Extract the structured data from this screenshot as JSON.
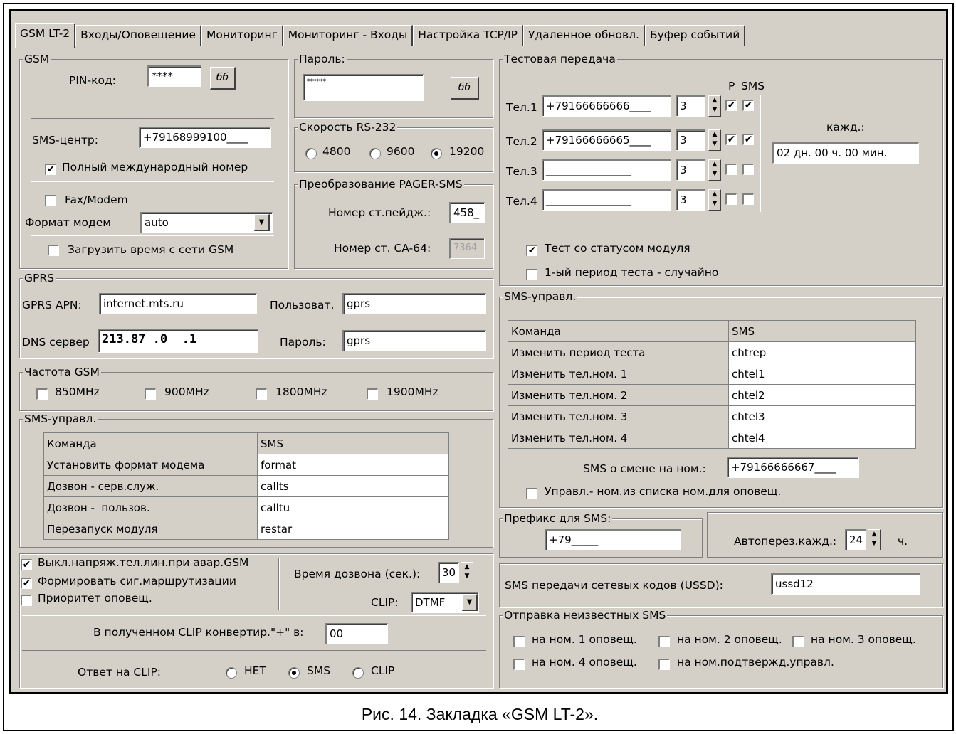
{
  "tabs": [
    "GSM LT-2",
    "Входы/Оповещение",
    "Мониторинг",
    "Мониторинг - Входы",
    "Настройка TCP/IP",
    "Удаленное обновл.",
    "Буфер событий"
  ],
  "gsm": {
    "legend": "GSM",
    "pin_label": "PIN-код:",
    "pin_value": "****",
    "show_label": "бб",
    "sms_center_label": "SMS-центр:",
    "sms_center_value": "+79168999100____",
    "full_intl_label": "Полный международный номер",
    "fax_label": "Fax/Modem",
    "modem_format_label": "Формат модем",
    "modem_format_value": "auto",
    "load_time_label": "Загрузить время с сети GSM"
  },
  "password": {
    "legend": "Пароль:",
    "value": "******",
    "show_label": "бб"
  },
  "rs232": {
    "legend": "Скорость RS-232",
    "options": [
      "4800",
      "9600",
      "19200"
    ]
  },
  "pager": {
    "legend": "Преобразование PAGER-SMS",
    "pager_no_label": "Номер ст.пейдж.:",
    "pager_no_value": "458_",
    "ca64_label": "Номер ст. CA-64:",
    "ca64_value": "7364"
  },
  "test": {
    "legend": "Тестовая передача",
    "col_p": "P",
    "col_sms": "SMS",
    "rows": [
      {
        "label": "Тел.1",
        "phone": "+79166666666____",
        "n": "3"
      },
      {
        "label": "Тел.2",
        "phone": "+79166666665____",
        "n": "3"
      },
      {
        "label": "Тел.3",
        "phone": "________________",
        "n": "3"
      },
      {
        "label": "Тел.4",
        "phone": "________________",
        "n": "3"
      }
    ],
    "every_label": "кажд.:",
    "every_value": "02 дн. 00 ч. 00 мин.",
    "status_label": "Тест со статусом модуля",
    "random_label": "1-ый период теста - случайно"
  },
  "gprs": {
    "legend": "GPRS",
    "apn_label": "GPRS APN:",
    "apn_value": "internet.mts.ru",
    "user_label": "Пользоват.",
    "user_value": "gprs",
    "dns_label": "DNS сервер",
    "dns_value": "213.87 .0  .1",
    "pass_label": "Пароль:",
    "pass_value": "gprs"
  },
  "freq": {
    "legend": "Частота GSM",
    "options": [
      "850MHz",
      "900MHz",
      "1800MHz",
      "1900MHz"
    ]
  },
  "sms_left": {
    "legend": "SMS-управл.",
    "header": [
      "Команда",
      "SMS"
    ],
    "rows": [
      [
        "Установить формат модема",
        "format"
      ],
      [
        "Дозвон - серв.служ.",
        "callts"
      ],
      [
        "Дозвон -  пользов.",
        "calltu"
      ],
      [
        "Перезапуск модуля",
        "restar"
      ]
    ]
  },
  "sms_right": {
    "legend": "SMS-управл.",
    "header": [
      "Команда",
      "SMS"
    ],
    "rows": [
      [
        "Изменить период теста",
        "chtrep"
      ],
      [
        "Изменить тел.ном. 1",
        "chtel1"
      ],
      [
        "Изменить тел.ном. 2",
        "chtel2"
      ],
      [
        "Изменить тел.ном. 3",
        "chtel3"
      ],
      [
        "Изменить тел.ном. 4",
        "chtel4"
      ]
    ],
    "change_label": "SMS о смене на ном.:",
    "change_value": "+79166666667____",
    "notify_list_label": "Управл.- ном.из списка ном.для оповещ."
  },
  "bottom_left": {
    "opt1": "Выкл.напряж.тел.лин.при авар.GSM",
    "opt2": "Формировать сиг.маршрутизации",
    "opt3": "Приоритет оповещ.",
    "dial_time_label": "Время дозвона (сек.):",
    "dial_time_value": "30",
    "clip_label": "CLIP:",
    "clip_value": "DTMF",
    "convert_label": "В полученном CLIP конвертир.\"+\" в:",
    "convert_value": "00",
    "answer_label": "Ответ на CLIP:",
    "answer_options": [
      "НЕТ",
      "SMS",
      "CLIP"
    ]
  },
  "prefix": {
    "legend": "Префикс для SMS:",
    "value": "+79_____",
    "autorestart_label": "Автоперез.кажд.:",
    "autorestart_value": "24",
    "autorestart_unit": "ч."
  },
  "ussd": {
    "label": "SMS передачи сетевых кодов (USSD):",
    "value": "ussd12"
  },
  "unknown": {
    "legend": "Отправка неизвестных SMS",
    "options": [
      "на ном. 1 оповещ.",
      "на ном. 2 оповещ.",
      "на ном. 3 оповещ.",
      "на ном. 4 оповещ.",
      "на ном.подтвержд.управл."
    ]
  },
  "caption": "Рис. 14. Закладка «GSM LT-2»."
}
